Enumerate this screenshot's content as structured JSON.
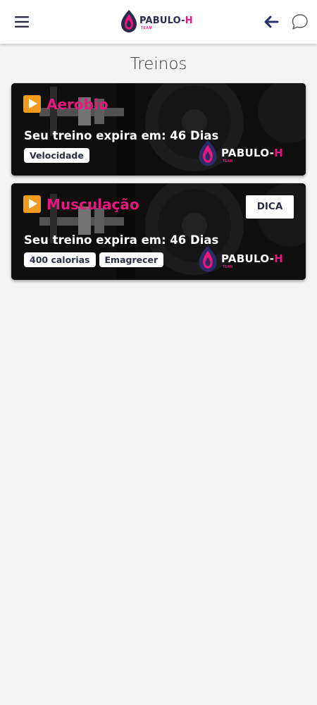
{
  "header": {
    "logo_main": "PABULO-",
    "logo_accent": "H",
    "logo_sub": "TEAM",
    "icons": [
      "menu-icon",
      "arrow-left-icon",
      "chat-bubble-icon"
    ]
  },
  "page": {
    "title": "Treinos"
  },
  "colors": {
    "accent": "#e8177d",
    "play": "#f39b1c",
    "navy": "#2a2f45"
  },
  "cards": [
    {
      "title": "Aeróbio",
      "expire_text": "Seu treino expira em: 46 Dias",
      "tags": [
        "Velocidade"
      ],
      "brand_main": "PABULO-",
      "brand_accent": "H",
      "brand_sub": "TEAM"
    },
    {
      "title": "Musculação",
      "expire_text": "Seu treino expira em: 46 Dias",
      "tags": [
        "400 calorias",
        "Emagrecer"
      ],
      "action_label": "DICA",
      "brand_main": "PABULO-",
      "brand_accent": "H",
      "brand_sub": "TEAM"
    }
  ]
}
